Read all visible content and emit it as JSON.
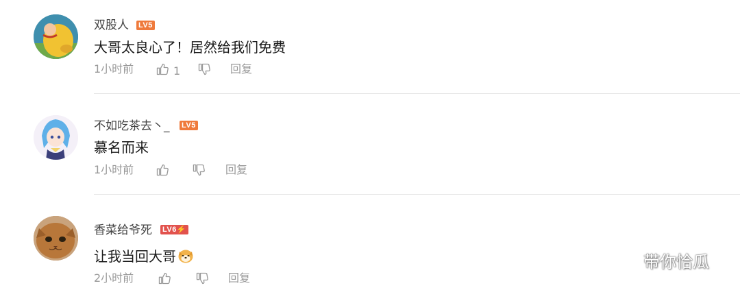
{
  "comments": [
    {
      "username": "双股人",
      "level": "LV5",
      "level_color": "#ef7a3c",
      "text": "大哥太良心了！居然给我们免费",
      "time": "1小时前",
      "likes": "1",
      "reply_label": "回复"
    },
    {
      "username": "不如吃茶去丶_",
      "level": "LV5",
      "level_color": "#ef7a3c",
      "text": "慕名而来",
      "time": "1小时前",
      "likes": "",
      "reply_label": "回复"
    },
    {
      "username": "香菜给爷死",
      "level": "LV6⚡",
      "level_color": "#e2524d",
      "text": "让我当回大哥",
      "time": "2小时前",
      "likes": "",
      "reply_label": "回复"
    }
  ],
  "watermark": {
    "text": "带你恰瓜"
  },
  "icons": [
    "thumb-up-icon",
    "thumb-down-icon",
    "wechat-icon",
    "dog-emoji-icon"
  ]
}
